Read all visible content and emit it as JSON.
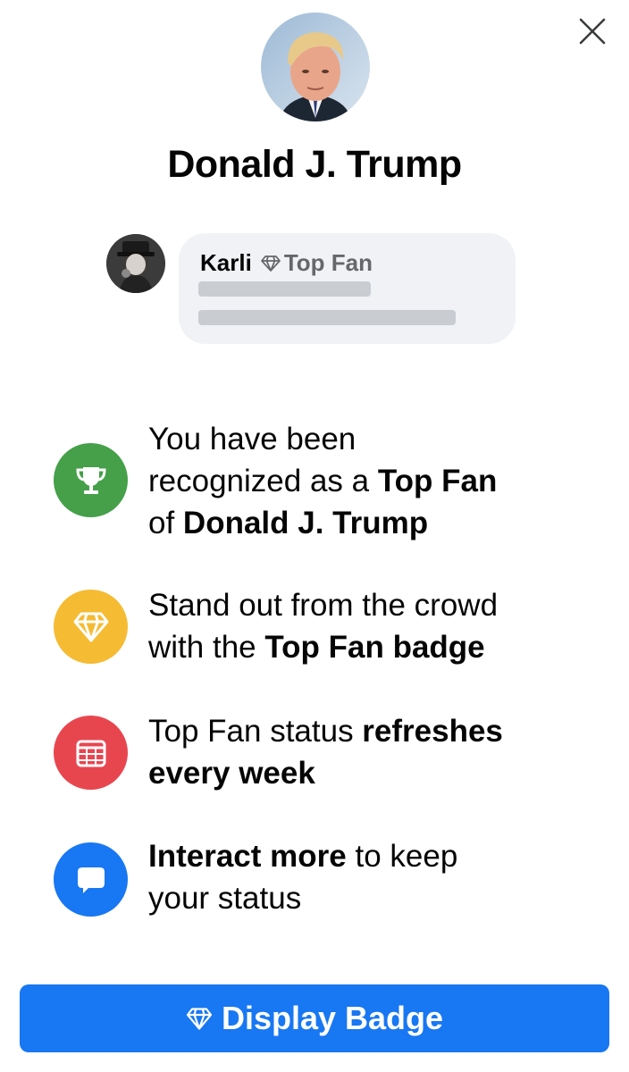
{
  "page": {
    "name": "Donald J. Trump"
  },
  "comment_preview": {
    "author": "Karli",
    "badge_label": "Top Fan"
  },
  "features": [
    {
      "icon": "trophy-icon",
      "color": "#45a049",
      "t1": "You have been",
      "t2": "recognized as a ",
      "t3": "Top Fan",
      "t4": "of ",
      "t5": "Donald J. Trump"
    },
    {
      "icon": "diamond-icon",
      "color": "#f5bb33",
      "t1": "Stand out from the crowd",
      "t2": "with the ",
      "t3": "Top Fan badge"
    },
    {
      "icon": "calendar-icon",
      "color": "#e8464f",
      "t1": "Top Fan status ",
      "t2": "refreshes",
      "t3": "every week"
    },
    {
      "icon": "speech-bubble-icon",
      "color": "#1877f2",
      "t1": "Interact more",
      "t2": " to keep",
      "t3": "your status"
    }
  ],
  "action": {
    "label": "Display Badge",
    "color": "#1877f2"
  },
  "icons": {
    "close": "close-icon",
    "badge": "diamond-icon"
  }
}
